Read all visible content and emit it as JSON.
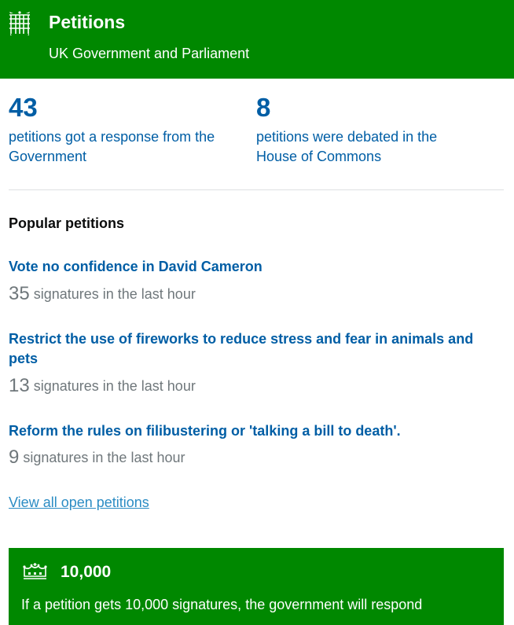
{
  "header": {
    "title": "Petitions",
    "subtitle": "UK Government and Parliament"
  },
  "stats": {
    "responded": {
      "number": "43",
      "text": "petitions got a response from the Government"
    },
    "debated": {
      "number": "8",
      "text": "petitions were debated in the House of Commons"
    }
  },
  "popular": {
    "title": "Popular petitions",
    "items": [
      {
        "title": "Vote no confidence in David Cameron",
        "count": "35",
        "suffix": " signatures in the last hour"
      },
      {
        "title": "Restrict the use of fireworks to reduce stress and fear in animals and pets",
        "count": "13",
        "suffix": " signatures in the last hour"
      },
      {
        "title": "Reform the rules on filibustering or 'talking a bill to death'.",
        "count": "9",
        "suffix": " signatures in the last hour"
      }
    ],
    "view_all": "View all open petitions"
  },
  "threshold": {
    "number": "10,000",
    "text": "If a petition gets 10,000 signatures, the government will respond"
  },
  "icons": {
    "header_logo": "portcullis-icon",
    "threshold": "crown-icon"
  },
  "colors": {
    "brand_green": "#008800",
    "link_blue": "#005ea5",
    "secondary_text": "#6f777b",
    "view_all_link": "#2b8cc4"
  }
}
